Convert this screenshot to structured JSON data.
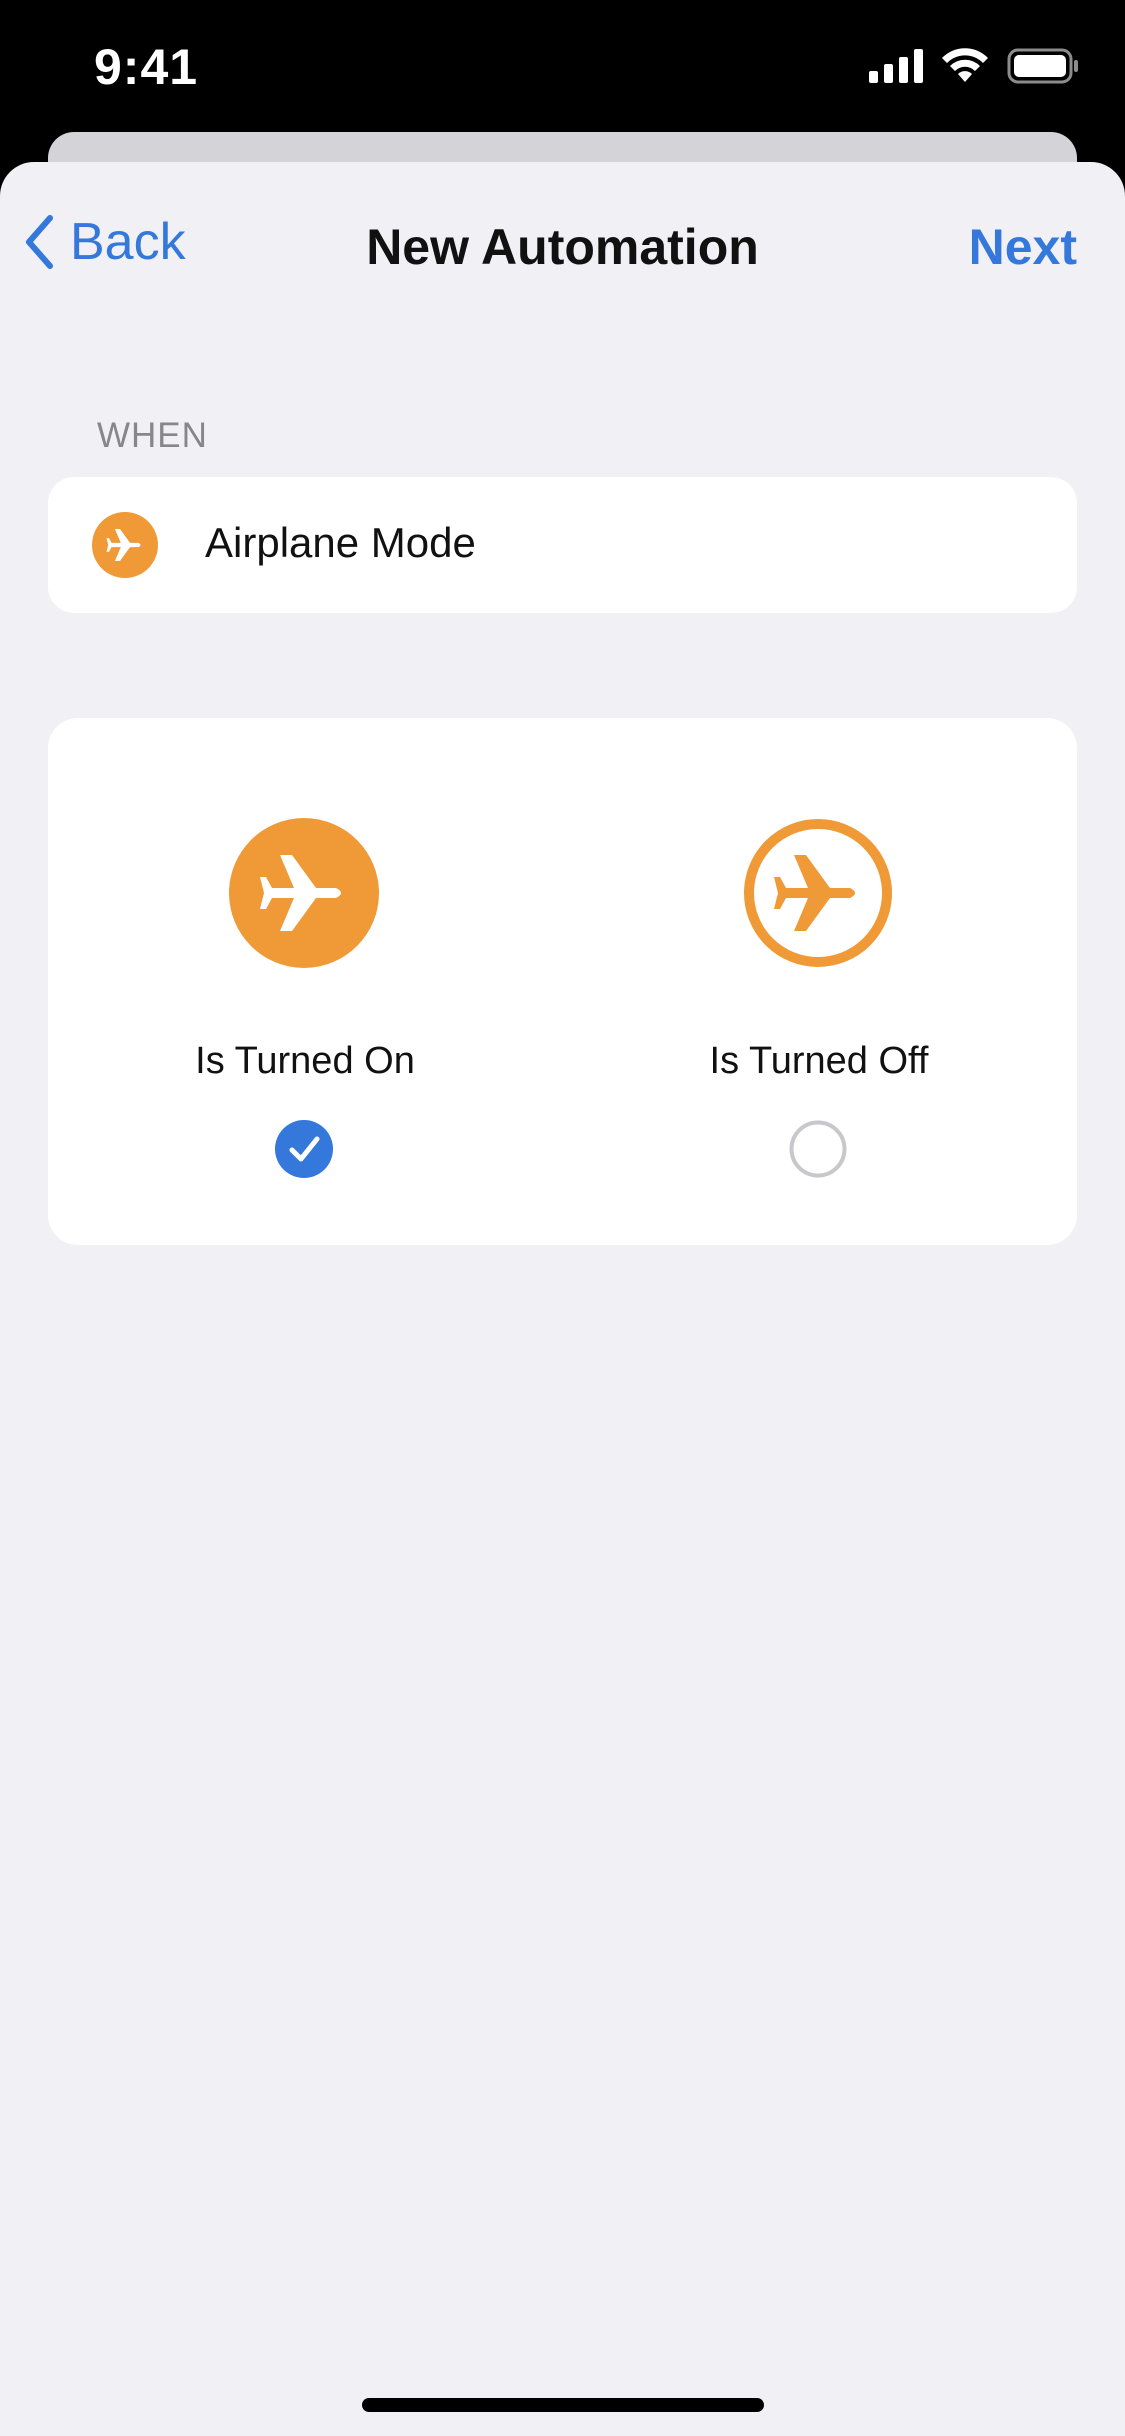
{
  "status_bar": {
    "time": "9:41"
  },
  "nav": {
    "back_label": "Back",
    "title": "New Automation",
    "next_label": "Next"
  },
  "trigger": {
    "section_header": "WHEN",
    "label": "Airplane Mode",
    "icon": "airplane-icon"
  },
  "options": [
    {
      "label": "Is Turned On",
      "selected": true,
      "icon": "airplane-filled-icon"
    },
    {
      "label": "Is Turned Off",
      "selected": false,
      "icon": "airplane-outline-icon"
    }
  ],
  "colors": {
    "accent_blue": "#3478dc",
    "airplane_orange": "#f09a37",
    "background": "#f0f0f5",
    "card": "#ffffff"
  }
}
